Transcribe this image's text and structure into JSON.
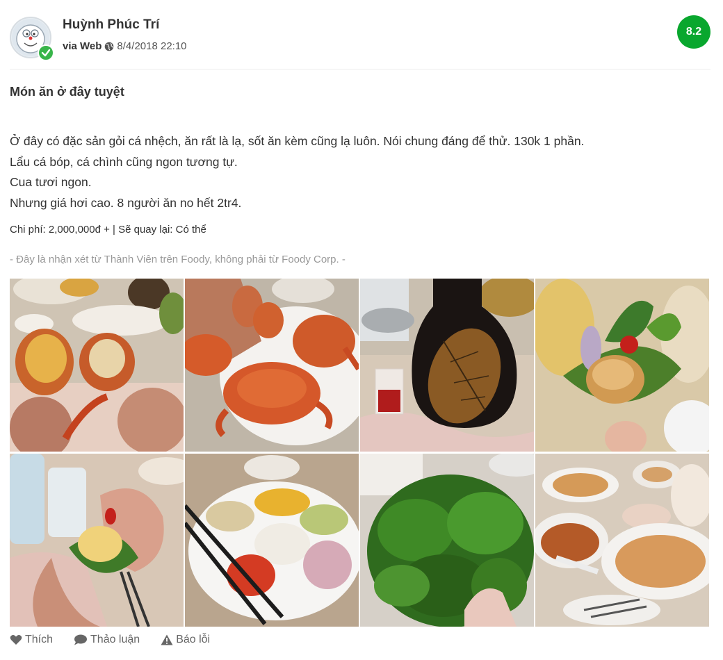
{
  "author": {
    "name": "Huỳnh Phúc Trí",
    "via": "via Web",
    "date": "8/4/2018 22:10"
  },
  "score": "8.2",
  "review": {
    "title": "Món ăn ở đây tuyệt",
    "lines": [
      "Ở đây có đặc sản gỏi cá nhệch, ăn rất là lạ, sốt ăn kèm cũng lạ luôn. Nói chung đáng để thử. 130k 1 phần.",
      "Lẩu cá bóp, cá chình cũng ngon tương tự.",
      "Cua tươi ngon.",
      "Nhưng giá hơi cao. 8 người ăn no hết 2tr4."
    ],
    "cost_line": "Chi phí: 2,000,000đ + | Sẽ quay lại: Có thể",
    "disclaimer": "- Đây là nhận xét từ Thành Viên trên Foody, không phải từ Foody Corp. -"
  },
  "footer": {
    "like_label": "Thích",
    "discuss_label": "Thảo luận",
    "report_label": "Báo lỗi"
  },
  "colors": {
    "score_bg": "#09a72e",
    "verified": "#39b54a",
    "muted_text": "#999999",
    "action_text": "#666666"
  },
  "icons": {
    "verified": "check-icon",
    "via": "globe-icon",
    "like": "heart-icon",
    "discuss": "speech-bubble-icon",
    "report": "warning-icon"
  }
}
